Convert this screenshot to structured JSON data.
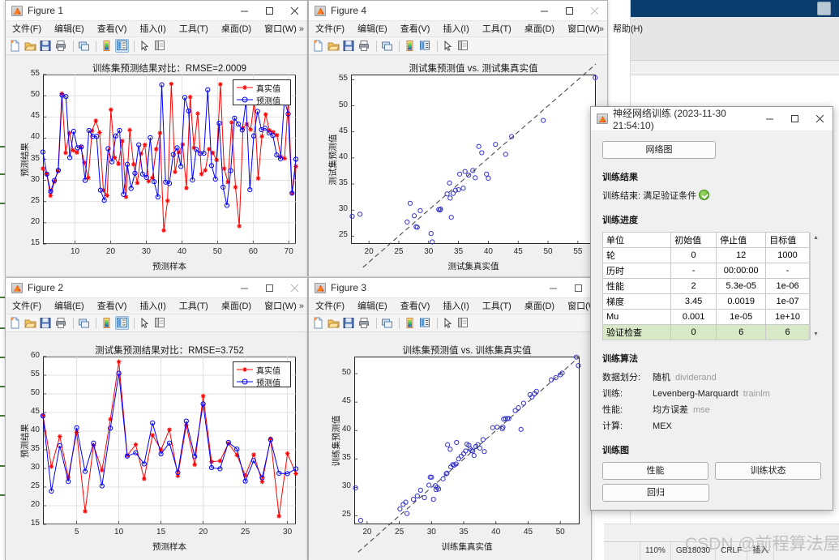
{
  "ide": {
    "status": {
      "zoom": "110%",
      "encoding": "GB18030",
      "eol": "CRLF",
      "mode": "插入"
    },
    "watermark": "CSDN @前程算法屋"
  },
  "figure_menu": [
    "文件(F)",
    "编辑(E)",
    "查看(V)",
    "插入(I)",
    "工具(T)",
    "桌面(D)",
    "窗口(W)",
    "帮助(H)"
  ],
  "figure_menu_more": "»",
  "toolbar_icons": [
    "new-figure-icon",
    "open-icon",
    "save-icon",
    "print-icon",
    "link-plot-icon",
    "colorbar-icon",
    "legend-icon",
    "pointer-icon",
    "property-inspector-icon"
  ],
  "window_controls": {
    "minimize": "–",
    "maximize": "☐",
    "close": "✕"
  },
  "figures": [
    {
      "title": "Figure 1"
    },
    {
      "title": "Figure 4"
    },
    {
      "title": "Figure 2"
    },
    {
      "title": "Figure 3"
    }
  ],
  "chart_data": [
    {
      "id": "fig1",
      "type": "line",
      "title": "训练集预测结果对比：RMSE=2.0009",
      "xlabel": "预测样本",
      "ylabel": "预测结果",
      "xlim": [
        1,
        72
      ],
      "ylim": [
        15,
        55
      ],
      "xticks": [
        10,
        20,
        30,
        40,
        50,
        60,
        70
      ],
      "yticks": [
        15,
        20,
        25,
        30,
        35,
        40,
        45,
        50,
        55
      ],
      "grid": true,
      "legend": [
        "真实值",
        "预测值"
      ],
      "legend_position": "top-right",
      "series": [
        {
          "name": "真实值",
          "color": "#ff0000",
          "marker": "star",
          "values": [
            32.8,
            31.5,
            26.4,
            29.7,
            32.2,
            50.5,
            36.5,
            41.2,
            37.1,
            36.6,
            37.9,
            34.2,
            30.6,
            41.7,
            44.1,
            41.3,
            27.7,
            26.4,
            46.7,
            35.4,
            33.9,
            39.3,
            26.1,
            41.9,
            33.8,
            29.4,
            36.3,
            38.4,
            29.8,
            30.6,
            37.4,
            41.2,
            18.2,
            25.2,
            52.8,
            32.0,
            36.6,
            38.5,
            28.2,
            49.7,
            37.7,
            45.8,
            31.5,
            32.4,
            37.4,
            36.5,
            34.8,
            52.7,
            32.8,
            29.6,
            43.7,
            28.4,
            19.2,
            42.4,
            43.3,
            42.0,
            48.7,
            30.5,
            40.4,
            45.6,
            41.8,
            41.4,
            40.7,
            35.6,
            35.2,
            49.0,
            27.0,
            33.3
          ]
        },
        {
          "name": "预测值",
          "color": "#0000ff",
          "marker": "circle",
          "values": [
            36.7,
            31.5,
            27.4,
            30.0,
            32.4,
            50.1,
            49.8,
            35.4,
            41.6,
            37.7,
            37.9,
            30.0,
            41.8,
            40.4,
            40.4,
            27.7,
            25.3,
            37.5,
            34.4,
            40.5,
            41.8,
            26.7,
            33.8,
            28.1,
            31.7,
            38.4,
            31.5,
            30.7,
            40.1,
            29.7,
            26.1,
            52.6,
            29.6,
            29.3,
            36.1,
            37.7,
            33.3,
            49.6,
            46.4,
            30.1,
            37.3,
            36.4,
            36.4,
            51.4,
            33.5,
            30.3,
            43.5,
            28.4,
            24.1,
            32.3,
            44.7,
            43.3,
            41.9,
            48.7,
            27.8,
            40.5,
            46.3,
            42.0,
            42.3,
            41.2,
            40.6,
            36.0,
            35.1,
            49.0,
            45.7,
            27.0,
            35.0
          ]
        }
      ]
    },
    {
      "id": "fig4",
      "type": "scatter",
      "title": "测试集预测值 vs. 测试集真实值",
      "xlabel": "测试集真实值",
      "ylabel": "测试集预测值",
      "xlim": [
        17,
        58
      ],
      "ylim": [
        23.5,
        56
      ],
      "xticks": [
        20,
        25,
        30,
        35,
        40,
        45,
        50,
        55
      ],
      "yticks": [
        25,
        30,
        35,
        40,
        45,
        50,
        55
      ],
      "grid": false,
      "reference_line": {
        "style": "dashed",
        "color": "#3a3a3a",
        "from": [
          19,
          19
        ],
        "to": [
          58,
          58
        ]
      },
      "marker": {
        "shape": "circle",
        "color": "#3333cc",
        "filled": false
      },
      "points": [
        [
          17.2,
          28.8
        ],
        [
          18.5,
          29.2
        ],
        [
          26.4,
          27.7
        ],
        [
          26.9,
          31.3
        ],
        [
          27.6,
          28.9
        ],
        [
          27.9,
          26.8
        ],
        [
          28.1,
          26.7
        ],
        [
          28.6,
          29.9
        ],
        [
          30.4,
          25.5
        ],
        [
          30.6,
          23.9
        ],
        [
          31.7,
          30.1
        ],
        [
          31.9,
          30.0
        ],
        [
          32.0,
          30.2
        ],
        [
          33.1,
          33.1
        ],
        [
          33.5,
          35.2
        ],
        [
          33.6,
          32.3
        ],
        [
          33.8,
          28.6
        ],
        [
          34.1,
          33.2
        ],
        [
          34.5,
          33.8
        ],
        [
          35.0,
          33.9
        ],
        [
          35.2,
          36.9
        ],
        [
          35.8,
          34.2
        ],
        [
          36.1,
          37.4
        ],
        [
          36.7,
          36.7
        ],
        [
          37.4,
          37.6
        ],
        [
          37.8,
          36.2
        ],
        [
          38.4,
          42.2
        ],
        [
          38.9,
          41.0
        ],
        [
          39.7,
          36.9
        ],
        [
          40.0,
          36.1
        ],
        [
          41.2,
          42.6
        ],
        [
          42.9,
          40.7
        ],
        [
          43.9,
          44.1
        ],
        [
          49.2,
          47.2
        ],
        [
          57.9,
          55.4
        ]
      ]
    },
    {
      "id": "fig2",
      "type": "line",
      "title": "测试集预测结果对比：RMSE=3.752",
      "xlabel": "预测样本",
      "ylabel": "预测结果",
      "xlim": [
        1,
        31
      ],
      "ylim": [
        15,
        60
      ],
      "xticks": [
        5,
        10,
        15,
        20,
        25,
        30
      ],
      "yticks": [
        15,
        20,
        25,
        30,
        35,
        40,
        45,
        50,
        55,
        60
      ],
      "grid": true,
      "legend": [
        "真实值",
        "预测值"
      ],
      "legend_position": "top-right",
      "series": [
        {
          "name": "真实值",
          "color": "#ff0000",
          "marker": "star",
          "values": [
            44.2,
            30.5,
            38.6,
            27.6,
            39.7,
            18.5,
            36.2,
            29.5,
            43.2,
            58.6,
            33.5,
            36.4,
            27.2,
            38.9,
            35.0,
            40.4,
            28.0,
            41.6,
            31.0,
            49.4,
            31.8,
            32.0,
            36.7,
            33.6,
            28.1,
            33.7,
            26.4,
            38.0,
            17.2,
            34.0,
            28.6
          ]
        },
        {
          "name": "预测值",
          "color": "#0000ff",
          "marker": "circle",
          "values": [
            44.1,
            23.9,
            36.1,
            26.5,
            40.9,
            29.2,
            36.8,
            25.3,
            40.8,
            55.5,
            33.3,
            34.2,
            31.2,
            42.2,
            33.9,
            36.8,
            28.9,
            42.7,
            33.2,
            47.3,
            30.2,
            29.9,
            37.0,
            35.2,
            26.6,
            32.1,
            27.5,
            37.7,
            28.7,
            28.6,
            29.9
          ]
        }
      ]
    },
    {
      "id": "fig3",
      "type": "scatter",
      "title": "训练集预测值 vs. 训练集真实值",
      "xlabel": "训练集真实值",
      "ylabel": "训练集预测值",
      "xlim": [
        18,
        53
      ],
      "ylim": [
        23.5,
        53
      ],
      "xticks": [
        20,
        25,
        30,
        35,
        40,
        45,
        50
      ],
      "yticks": [
        25,
        30,
        35,
        40,
        45,
        50
      ],
      "grid": false,
      "reference_line": {
        "style": "dashed",
        "color": "#3a3a3a",
        "from": [
          18.6,
          18.6
        ],
        "to": [
          53,
          53
        ]
      },
      "marker": {
        "shape": "circle",
        "color": "#3333cc",
        "filled": false
      },
      "points": [
        [
          18.2,
          29.9
        ],
        [
          19.0,
          24.2
        ],
        [
          25.1,
          26.2
        ],
        [
          25.6,
          27.0
        ],
        [
          26.0,
          27.4
        ],
        [
          26.2,
          25.4
        ],
        [
          27.2,
          27.9
        ],
        [
          27.8,
          28.5
        ],
        [
          28.3,
          29.5
        ],
        [
          28.9,
          28.2
        ],
        [
          29.6,
          30.4
        ],
        [
          29.8,
          31.8
        ],
        [
          30.0,
          31.8
        ],
        [
          30.3,
          27.9
        ],
        [
          30.6,
          30.3
        ],
        [
          30.7,
          29.6
        ],
        [
          30.9,
          30.0
        ],
        [
          31.1,
          29.7
        ],
        [
          31.8,
          31.5
        ],
        [
          32.3,
          32.4
        ],
        [
          32.4,
          32.5
        ],
        [
          32.5,
          37.5
        ],
        [
          32.9,
          36.7
        ],
        [
          33.0,
          33.6
        ],
        [
          33.3,
          34.0
        ],
        [
          33.5,
          33.9
        ],
        [
          33.8,
          34.1
        ],
        [
          33.9,
          37.9
        ],
        [
          34.2,
          35.0
        ],
        [
          34.6,
          35.5
        ],
        [
          35.0,
          35.9
        ],
        [
          35.3,
          36.4
        ],
        [
          35.5,
          37.6
        ],
        [
          35.8,
          37.4
        ],
        [
          36.0,
          36.8
        ],
        [
          36.2,
          36.5
        ],
        [
          36.4,
          36.4
        ],
        [
          36.6,
          35.6
        ],
        [
          36.9,
          37.2
        ],
        [
          37.2,
          37.5
        ],
        [
          37.5,
          36.9
        ],
        [
          38.0,
          38.4
        ],
        [
          38.2,
          36.3
        ],
        [
          39.5,
          40.5
        ],
        [
          40.2,
          40.6
        ],
        [
          41.0,
          40.3
        ],
        [
          41.1,
          40.6
        ],
        [
          41.2,
          42.0
        ],
        [
          41.5,
          42.1
        ],
        [
          41.8,
          42.1
        ],
        [
          42.0,
          42.1
        ],
        [
          43.0,
          43.5
        ],
        [
          43.5,
          44.0
        ],
        [
          43.9,
          40.2
        ],
        [
          44.3,
          44.8
        ],
        [
          45.3,
          46.3
        ],
        [
          45.6,
          45.9
        ],
        [
          46.0,
          46.5
        ],
        [
          46.3,
          46.9
        ],
        [
          48.6,
          48.9
        ],
        [
          49.3,
          49.3
        ],
        [
          50.0,
          49.8
        ],
        [
          50.3,
          50.1
        ],
        [
          52.5,
          52.9
        ],
        [
          52.8,
          51.4
        ]
      ]
    }
  ],
  "nntrain": {
    "title": "神经网络训练 (2023-11-30 21:54:10)",
    "network_diagram_button": "网络图",
    "results_heading": "训练结果",
    "results_line": "训练结束: 满足验证条件",
    "progress_heading": "训练进度",
    "progress_table": {
      "headers": [
        "单位",
        "初始值",
        "停止值",
        "目标值"
      ],
      "rows": [
        {
          "unit": "轮",
          "initial": "0",
          "stop": "12",
          "target": "1000",
          "highlight": false
        },
        {
          "unit": "历时",
          "initial": "-",
          "stop": "00:00:00",
          "target": "-",
          "highlight": false
        },
        {
          "unit": "性能",
          "initial": "2",
          "stop": "5.3e-05",
          "target": "1e-06",
          "highlight": false
        },
        {
          "unit": "梯度",
          "initial": "3.45",
          "stop": "0.0019",
          "target": "1e-07",
          "highlight": false
        },
        {
          "unit": "Mu",
          "initial": "0.001",
          "stop": "1e-05",
          "target": "1e+10",
          "highlight": false
        },
        {
          "unit": "验证检查",
          "initial": "0",
          "stop": "6",
          "target": "6",
          "highlight": true
        }
      ]
    },
    "algorithm_heading": "训练算法",
    "algorithm_rows": [
      {
        "label": "数据划分:",
        "value": "随机",
        "fn": "dividerand"
      },
      {
        "label": "训练:",
        "value": "Levenberg-Marquardt",
        "fn": "trainlm"
      },
      {
        "label": "性能:",
        "value": "均方误差",
        "fn": "mse"
      },
      {
        "label": "计算:",
        "value": "MEX",
        "fn": ""
      }
    ],
    "plots_heading": "训练图",
    "plot_buttons": [
      "性能",
      "训练状态",
      "回归"
    ]
  }
}
